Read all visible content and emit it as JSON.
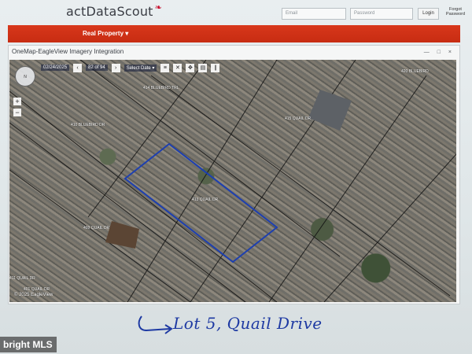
{
  "header": {
    "logo": "actDataScout",
    "email_placeholder": "Email",
    "password_placeholder": "Password",
    "login_label": "Login",
    "forgot_label": "Forgot Password"
  },
  "nav": {
    "item": "Real Property ▾"
  },
  "window": {
    "title": "OneMap-EagleView Imagery Integration",
    "controls": "— □ ×"
  },
  "map": {
    "date": "02/24/2025",
    "frame": "82 of 94",
    "select_date": "Select Date ▾",
    "parcels": [
      {
        "label": "414 BLUEBIRD TRL"
      },
      {
        "label": "410 BLUEBIRD DR"
      },
      {
        "label": "415 QUAIL DR"
      },
      {
        "label": "420 BLUEBIRD"
      },
      {
        "label": "413 QUAIL DR"
      },
      {
        "label": "409 QUAIL DR"
      },
      {
        "label": "411 QUAIL DR"
      },
      {
        "label": "401 QUAIL DR"
      }
    ],
    "copyright": "© 2025 EagleView"
  },
  "annotation": {
    "text": "Lot 5, Quail Drive"
  },
  "watermark": "bright MLS",
  "colors": {
    "nav_red": "#d23419",
    "boundary_blue": "#1d3fb0",
    "ink_blue": "#1e3aa3"
  }
}
